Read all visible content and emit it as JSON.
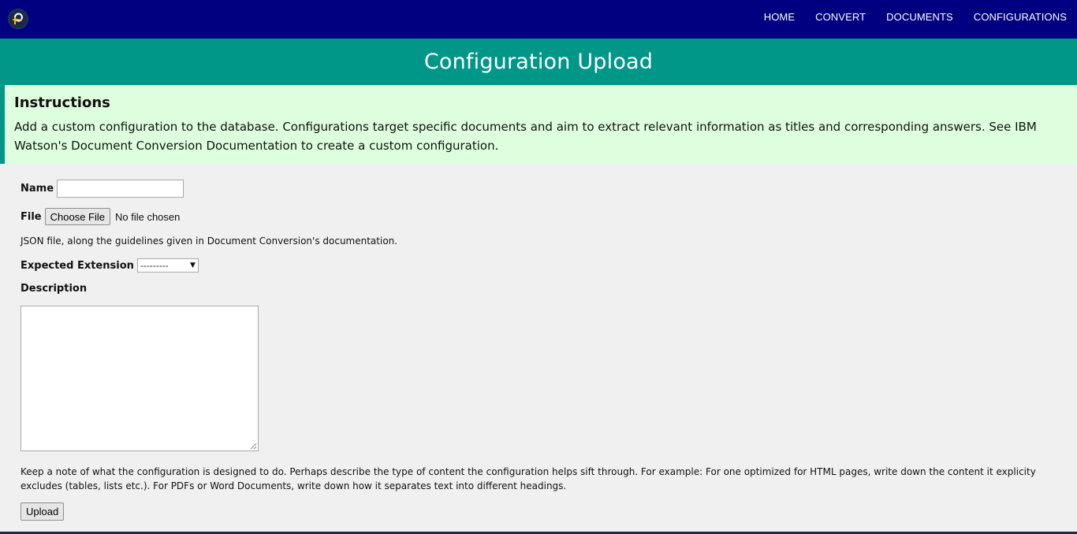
{
  "nav": {
    "logo_icon": "p-logo-icon",
    "items": [
      {
        "label": "HOME"
      },
      {
        "label": "CONVERT"
      },
      {
        "label": "DOCUMENTS"
      },
      {
        "label": "CONFIGURATIONS"
      }
    ]
  },
  "page": {
    "title": "Configuration Upload"
  },
  "instructions": {
    "heading": "Instructions",
    "body": "Add a custom configuration to the database. Configurations target specific documents and aim to extract relevant information as titles and corresponding answers. See IBM Watson's Document Conversion Documentation to create a custom configuration."
  },
  "form": {
    "name_label": "Name",
    "name_value": "",
    "file_label": "File",
    "file_button": "Choose File",
    "file_status": "No file chosen",
    "file_help": "JSON file, along the guidelines given in Document Conversion's documentation.",
    "extension_label": "Expected Extension",
    "extension_selected": "---------",
    "description_label": "Description",
    "description_value": "",
    "description_help": "Keep a note of what the configuration is designed to do. Perhaps describe the type of content the configuration helps sift through. For example: For one optimized for HTML pages, write down the content it explicity excludes (tables, lists etc.). For PDFs or Word Documents, write down how it separates text into different headings.",
    "upload_button": "Upload"
  },
  "colors": {
    "nav_bg": "#000080",
    "title_bg": "#009688",
    "instructions_bg": "#ddffdd",
    "page_bg": "#f0f0f0"
  }
}
